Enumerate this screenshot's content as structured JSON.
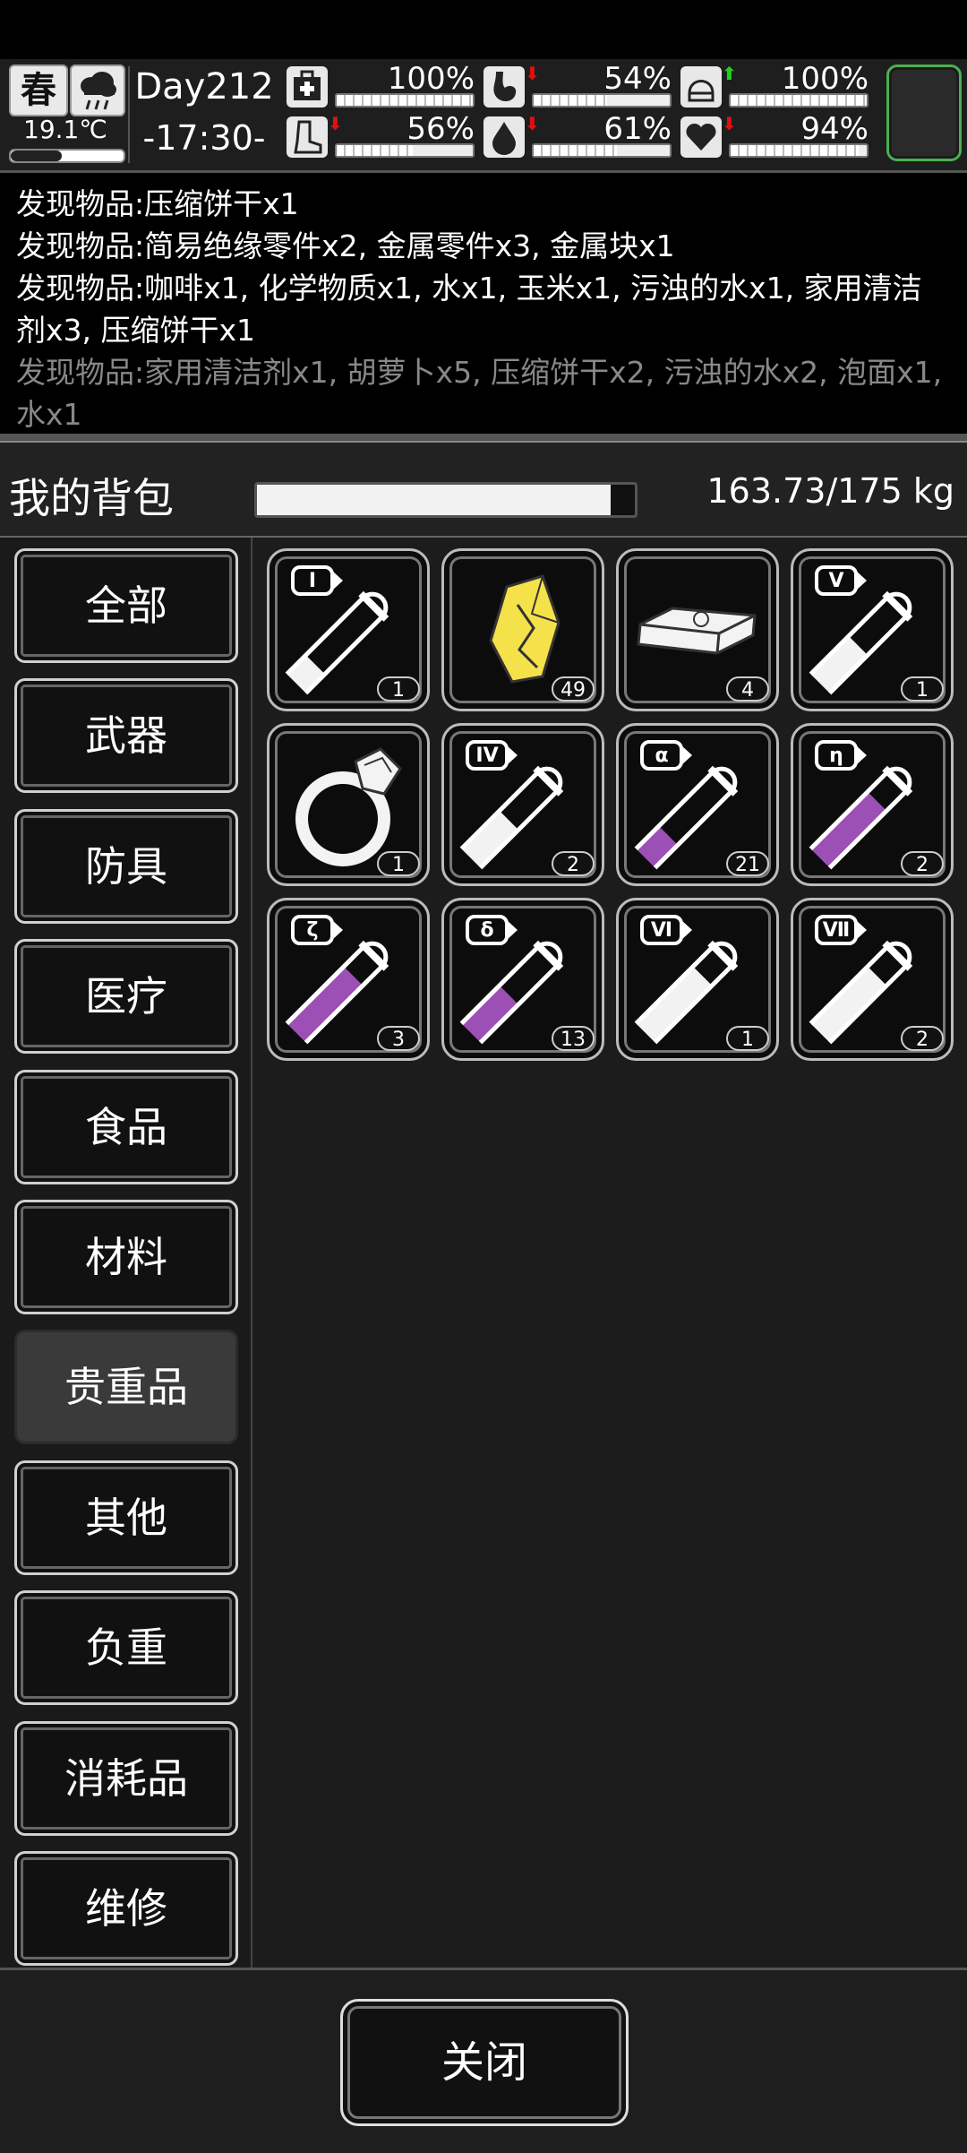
{
  "status": {
    "season": "春",
    "temperature": "19.1℃",
    "temperature_level": 0.45,
    "day": "Day212",
    "time": "-17:30-",
    "stats": [
      {
        "name": "health",
        "icon": "medkit-icon",
        "value_text": "100%",
        "value": 1.0,
        "arrow": ""
      },
      {
        "name": "hunger",
        "icon": "stomach-icon",
        "value_text": "54%",
        "value": 0.54,
        "arrow": "down"
      },
      {
        "name": "armor",
        "icon": "helmet-icon",
        "value_text": "100%",
        "value": 1.0,
        "arrow": "up"
      },
      {
        "name": "stamina",
        "icon": "boot-icon",
        "value_text": "56%",
        "value": 0.56,
        "arrow": "down"
      },
      {
        "name": "thirst",
        "icon": "water-drop-icon",
        "value_text": "61%",
        "value": 0.61,
        "arrow": "down"
      },
      {
        "name": "mood",
        "icon": "heart-icon",
        "value_text": "94%",
        "value": 0.94,
        "arrow": "down"
      }
    ]
  },
  "log": [
    "发现物品:压缩饼干x1",
    "发现物品:简易绝缘零件x2, 金属零件x3, 金属块x1",
    "发现物品:咖啡x1, 化学物质x1, 水x1, 玉米x1, 污浊的水x1, 家用清洁剂x3, 压缩饼干x1",
    "发现物品:家用清洁剂x1, 胡萝卜x5, 压缩饼干x2, 污浊的水x2, 泡面x1, 水x1"
  ],
  "inventory": {
    "title": "我的背包",
    "weight_text": "163.73/175 kg",
    "weight_fraction": 0.9356,
    "categories": [
      "全部",
      "武器",
      "防具",
      "医疗",
      "食品",
      "材料",
      "贵重品",
      "其他",
      "负重",
      "消耗品",
      "维修"
    ],
    "active_category": "贵重品",
    "items": [
      {
        "icon": "test-tube-icon",
        "label": "I",
        "liquid": "white",
        "level": 0.25,
        "count": "1"
      },
      {
        "icon": "gold-nugget-icon",
        "label": "",
        "count": "49"
      },
      {
        "icon": "cash-stack-icon",
        "label": "",
        "count": "4"
      },
      {
        "icon": "test-tube-icon",
        "label": "V",
        "liquid": "white",
        "level": 0.5,
        "count": "1"
      },
      {
        "icon": "ring-icon",
        "label": "",
        "count": "1"
      },
      {
        "icon": "test-tube-icon",
        "label": "IV",
        "liquid": "white",
        "level": 0.5,
        "count": "2"
      },
      {
        "icon": "test-tube-icon",
        "label": "α",
        "liquid": "purple",
        "level": 0.3,
        "count": "21"
      },
      {
        "icon": "test-tube-icon",
        "label": "η",
        "liquid": "purple",
        "level": 0.75,
        "count": "2"
      },
      {
        "icon": "test-tube-icon",
        "label": "ζ",
        "liquid": "purple",
        "level": 0.75,
        "count": "3"
      },
      {
        "icon": "test-tube-icon",
        "label": "δ",
        "liquid": "purple",
        "level": 0.5,
        "count": "13"
      },
      {
        "icon": "test-tube-icon",
        "label": "Ⅵ",
        "liquid": "white",
        "level": 0.75,
        "count": "1"
      },
      {
        "icon": "test-tube-icon",
        "label": "Ⅶ",
        "liquid": "white",
        "level": 0.75,
        "count": "2"
      }
    ]
  },
  "close_label": "关闭",
  "colors": {
    "liquid_white": "#f2f2f2",
    "liquid_purple": "#9c4fb5",
    "gold": "#f5e14a",
    "arrow_up": "#20d020",
    "arrow_down": "#e01010",
    "portrait_border": "#4caf50"
  }
}
